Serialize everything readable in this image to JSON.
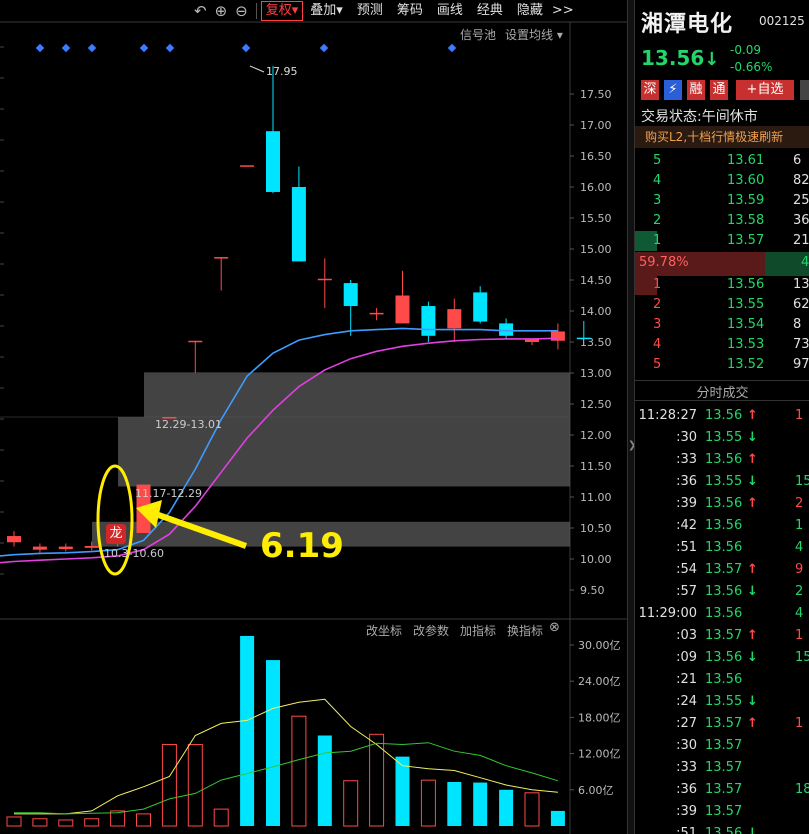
{
  "toolbar": {
    "undo_icon": "undo-icon",
    "zoom_in_icon": "zoom-in-icon",
    "zoom_out_icon": "zoom-out-icon",
    "fuquan": "复权",
    "diejia": "叠加",
    "yuce": "预测",
    "chouma": "筹码",
    "huaxian": "画线",
    "jingdian": "经典",
    "yincang": "隐藏",
    "more": ">>"
  },
  "chart_top_links": {
    "signal": "信号池",
    "ma_settings": "设置均线"
  },
  "indicator_links": {
    "change_axis": "改坐标",
    "change_params": "改参数",
    "add_indicator": "加指标",
    "switch_indicator": "换指标"
  },
  "annotation": {
    "value": "6.19",
    "long_badge": "龙",
    "high_marker": "17.95"
  },
  "zones": {
    "upper_label": "12.29-13.01",
    "middle_label": "11.17-12.29",
    "lower_label": "10.3-10.60"
  },
  "chart_data": {
    "type": "candlestick",
    "y_axis_ticks": [
      "17.50",
      "17.00",
      "16.50",
      "16.00",
      "15.50",
      "15.00",
      "14.50",
      "14.00",
      "13.50",
      "13.00",
      "12.50",
      "12.00",
      "11.50",
      "11.00",
      "10.50",
      "10.00",
      "9.50"
    ],
    "y_tick_values": [
      17.5,
      17.0,
      16.5,
      16.0,
      15.5,
      15.0,
      14.5,
      14.0,
      13.5,
      13.0,
      12.5,
      12.0,
      11.5,
      11.0,
      10.5,
      10.0,
      9.5
    ],
    "ylim": [
      9.2,
      17.95
    ],
    "candles": [
      {
        "o": 10.27,
        "h": 10.45,
        "l": 10.2,
        "c": 10.37,
        "dir": "up"
      },
      {
        "o": 10.15,
        "h": 10.25,
        "l": 10.1,
        "c": 10.2,
        "dir": "up"
      },
      {
        "o": 10.16,
        "h": 10.25,
        "l": 10.12,
        "c": 10.2,
        "dir": "up"
      },
      {
        "o": 10.18,
        "h": 10.28,
        "l": 10.14,
        "c": 10.21,
        "dir": "up"
      },
      {
        "o": 10.25,
        "h": 10.4,
        "l": 10.2,
        "c": 10.32,
        "dir": "up"
      },
      {
        "o": 10.42,
        "h": 11.2,
        "l": 10.42,
        "c": 11.2,
        "dir": "up"
      },
      {
        "o": 12.29,
        "h": 12.29,
        "l": 12.29,
        "c": 12.29,
        "dir": "up"
      },
      {
        "o": 13.5,
        "h": 13.52,
        "l": 13.0,
        "c": 13.52,
        "dir": "up"
      },
      {
        "o": 14.85,
        "h": 14.87,
        "l": 14.33,
        "c": 14.87,
        "dir": "up"
      },
      {
        "o": 16.35,
        "h": 16.35,
        "l": 16.35,
        "c": 16.35,
        "dir": "up"
      },
      {
        "o": 16.9,
        "h": 17.95,
        "l": 15.9,
        "c": 15.92,
        "dir": "down"
      },
      {
        "o": 16.0,
        "h": 16.33,
        "l": 14.8,
        "c": 14.8,
        "dir": "down"
      },
      {
        "o": 14.52,
        "h": 14.85,
        "l": 14.05,
        "c": 14.52,
        "dir": "up"
      },
      {
        "o": 14.45,
        "h": 14.5,
        "l": 13.6,
        "c": 14.08,
        "dir": "down"
      },
      {
        "o": 13.95,
        "h": 14.05,
        "l": 13.85,
        "c": 13.97,
        "dir": "up"
      },
      {
        "o": 13.8,
        "h": 14.65,
        "l": 13.8,
        "c": 14.25,
        "dir": "up"
      },
      {
        "o": 14.08,
        "h": 14.15,
        "l": 13.5,
        "c": 13.6,
        "dir": "down"
      },
      {
        "o": 13.72,
        "h": 14.2,
        "l": 13.5,
        "c": 14.03,
        "dir": "up"
      },
      {
        "o": 14.3,
        "h": 14.4,
        "l": 13.8,
        "c": 13.83,
        "dir": "down"
      },
      {
        "o": 13.8,
        "h": 13.88,
        "l": 13.55,
        "c": 13.6,
        "dir": "down"
      },
      {
        "o": 13.5,
        "h": 13.55,
        "l": 13.45,
        "c": 13.55,
        "dir": "up"
      },
      {
        "o": 13.52,
        "h": 13.8,
        "l": 13.38,
        "c": 13.67,
        "dir": "up"
      },
      {
        "o": 13.56,
        "h": 13.84,
        "l": 13.56,
        "c": 13.57,
        "dir": "down"
      }
    ],
    "ma_fast": [
      10.07,
      10.09,
      10.1,
      10.12,
      10.15,
      10.3,
      10.75,
      11.45,
      12.25,
      12.95,
      13.32,
      13.53,
      13.62,
      13.68,
      13.7,
      13.72,
      13.7,
      13.7,
      13.7,
      13.68,
      13.68,
      13.68
    ],
    "ma_slow": [
      9.96,
      9.98,
      10.0,
      10.02,
      10.05,
      10.15,
      10.4,
      10.85,
      11.4,
      11.95,
      12.4,
      12.78,
      13.05,
      13.23,
      13.35,
      13.43,
      13.48,
      13.52,
      13.54,
      13.55,
      13.55,
      13.56
    ],
    "volume_axis": [
      "30.00亿",
      "24.00亿",
      "18.00亿",
      "12.00亿",
      "6.00亿"
    ],
    "volume_tick_values": [
      30,
      24,
      18,
      12,
      6
    ],
    "volume_ylim": [
      0,
      36
    ],
    "volume": [
      {
        "v": 1.5,
        "dir": "up"
      },
      {
        "v": 1.2,
        "dir": "up"
      },
      {
        "v": 1.0,
        "dir": "up"
      },
      {
        "v": 1.2,
        "dir": "up"
      },
      {
        "v": 2.5,
        "dir": "up"
      },
      {
        "v": 2.0,
        "dir": "up"
      },
      {
        "v": 13.5,
        "dir": "up"
      },
      {
        "v": 13.5,
        "dir": "up"
      },
      {
        "v": 2.8,
        "dir": "up"
      },
      {
        "v": 31.5,
        "dir": "down"
      },
      {
        "v": 27.5,
        "dir": "down"
      },
      {
        "v": 18.2,
        "dir": "up"
      },
      {
        "v": 15.0,
        "dir": "down"
      },
      {
        "v": 7.5,
        "dir": "up"
      },
      {
        "v": 15.2,
        "dir": "up"
      },
      {
        "v": 11.5,
        "dir": "down"
      },
      {
        "v": 7.6,
        "dir": "up"
      },
      {
        "v": 7.3,
        "dir": "down"
      },
      {
        "v": 7.2,
        "dir": "down"
      },
      {
        "v": 6.0,
        "dir": "down"
      },
      {
        "v": 5.5,
        "dir": "up"
      },
      {
        "v": 2.5,
        "dir": "down"
      }
    ],
    "vol_ma_fast": [
      2.0,
      2.0,
      2.0,
      2.5,
      5.0,
      6.5,
      8.2,
      15.0,
      17.0,
      17.5,
      19.5,
      20.5,
      21.0,
      16.5,
      13.5,
      10.0,
      9.5,
      9.2,
      8.0,
      6.8,
      6.0,
      5.6
    ],
    "vol_ma_slow": [
      2.2,
      2.2,
      2.0,
      2.1,
      2.2,
      2.8,
      4.5,
      5.4,
      7.6,
      8.7,
      9.8,
      11.0,
      12.1,
      12.4,
      13.7,
      13.5,
      13.8,
      12.4,
      11.7,
      10.0,
      8.8,
      7.5
    ]
  },
  "stock": {
    "name": "湘潭电化",
    "code": "002125",
    "price": "13.56",
    "price_arrow": "↓",
    "change": "-0.09",
    "change_pct": "-0.66%",
    "tags": [
      "深",
      "⚡",
      "融",
      "通",
      "+自选"
    ],
    "status_label": "交易状态:午间休市",
    "banner": "购买L2,十档行情极速刷新"
  },
  "orderbook": {
    "asks": [
      {
        "lvl": "5",
        "price": "13.61",
        "vol": "6"
      },
      {
        "lvl": "4",
        "price": "13.60",
        "vol": "82"
      },
      {
        "lvl": "3",
        "price": "13.59",
        "vol": "25"
      },
      {
        "lvl": "2",
        "price": "13.58",
        "vol": "36"
      },
      {
        "lvl": "1",
        "price": "13.57",
        "vol": "21"
      }
    ],
    "ratio": "59.78%",
    "ratio_right": "4",
    "bids": [
      {
        "lvl": "1",
        "price": "13.56",
        "vol": "13"
      },
      {
        "lvl": "2",
        "price": "13.55",
        "vol": "62"
      },
      {
        "lvl": "3",
        "price": "13.54",
        "vol": "8"
      },
      {
        "lvl": "4",
        "price": "13.53",
        "vol": "73"
      },
      {
        "lvl": "5",
        "price": "13.52",
        "vol": "97"
      }
    ]
  },
  "ticks": {
    "title": "分时成交",
    "rows": [
      {
        "time": "11:28:27",
        "price": "13.56",
        "arrow": "↑",
        "vol": "1",
        "pc": "dn"
      },
      {
        "time": ":30",
        "price": "13.55",
        "arrow": "↓",
        "vol": "",
        "pc": "dn"
      },
      {
        "time": ":33",
        "price": "13.56",
        "arrow": "↑",
        "vol": "",
        "pc": "dn"
      },
      {
        "time": ":36",
        "price": "13.55",
        "arrow": "↓",
        "vol": "15",
        "pc": "dn"
      },
      {
        "time": ":39",
        "price": "13.56",
        "arrow": "↑",
        "vol": "2",
        "pc": "dn"
      },
      {
        "time": ":42",
        "price": "13.56",
        "arrow": "",
        "vol": "1",
        "pc": "dn"
      },
      {
        "time": ":51",
        "price": "13.56",
        "arrow": "",
        "vol": "4",
        "pc": "dn"
      },
      {
        "time": ":54",
        "price": "13.57",
        "arrow": "↑",
        "vol": "9",
        "pc": "dn"
      },
      {
        "time": ":57",
        "price": "13.56",
        "arrow": "↓",
        "vol": "2",
        "pc": "dn"
      },
      {
        "time": "11:29:00",
        "price": "13.56",
        "arrow": "",
        "vol": "4",
        "pc": "dn"
      },
      {
        "time": ":03",
        "price": "13.57",
        "arrow": "↑",
        "vol": "1",
        "pc": "dn"
      },
      {
        "time": ":09",
        "price": "13.56",
        "arrow": "↓",
        "vol": "15",
        "pc": "dn"
      },
      {
        "time": ":21",
        "price": "13.56",
        "arrow": "",
        "vol": "",
        "pc": "dn"
      },
      {
        "time": ":24",
        "price": "13.55",
        "arrow": "↓",
        "vol": "",
        "pc": "dn"
      },
      {
        "time": ":27",
        "price": "13.57",
        "arrow": "↑",
        "vol": "1",
        "pc": "dn"
      },
      {
        "time": ":30",
        "price": "13.57",
        "arrow": "",
        "vol": "",
        "pc": "dn"
      },
      {
        "time": ":33",
        "price": "13.57",
        "arrow": "",
        "vol": "",
        "pc": "dn"
      },
      {
        "time": ":36",
        "price": "13.57",
        "arrow": "",
        "vol": "18",
        "pc": "dn"
      },
      {
        "time": ":39",
        "price": "13.57",
        "arrow": "",
        "vol": "",
        "pc": "dn"
      },
      {
        "time": ":51",
        "price": "13.56",
        "arrow": "↓",
        "vol": "",
        "pc": "dn"
      }
    ]
  },
  "colors": {
    "up": "#ff4a4a",
    "down": "#00e5ff",
    "ma_fast": "#3f9bff",
    "ma_slow": "#e040e0",
    "vol_ma_fast": "#f2f060",
    "vol_ma_slow": "#32c832",
    "zone_fill": "#5a5a5a",
    "annotation": "#ffee00",
    "diamond": "#3a7dff"
  }
}
